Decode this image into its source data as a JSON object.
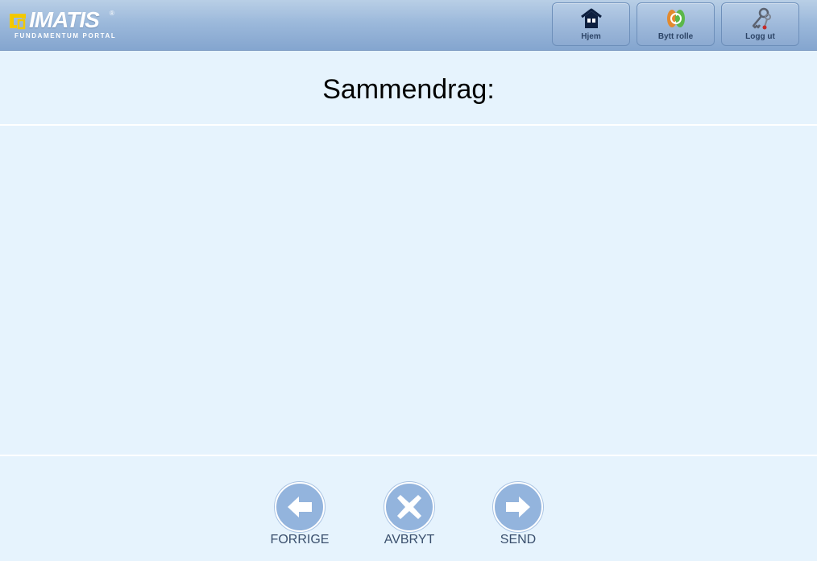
{
  "header": {
    "logo": {
      "name": "IMATIS",
      "registered": "®",
      "tagline": "FUNDAMENTUM PORTAL"
    },
    "nav": [
      {
        "label": "Hjem",
        "icon": "home-icon"
      },
      {
        "label": "Bytt rolle",
        "icon": "switch-role-icon"
      },
      {
        "label": "Logg ut",
        "icon": "keys-icon"
      }
    ]
  },
  "main": {
    "title": "Sammendrag:"
  },
  "actions": [
    {
      "label": "FORRIGE",
      "icon": "arrow-left-icon"
    },
    {
      "label": "AVBRYT",
      "icon": "close-icon"
    },
    {
      "label": "SEND",
      "icon": "arrow-right-icon"
    }
  ],
  "colors": {
    "page_background": "#e6f3fd",
    "header_background": "#9cb9db",
    "action_circle": "#93b4dd",
    "logo_accent": "#f2c800"
  }
}
